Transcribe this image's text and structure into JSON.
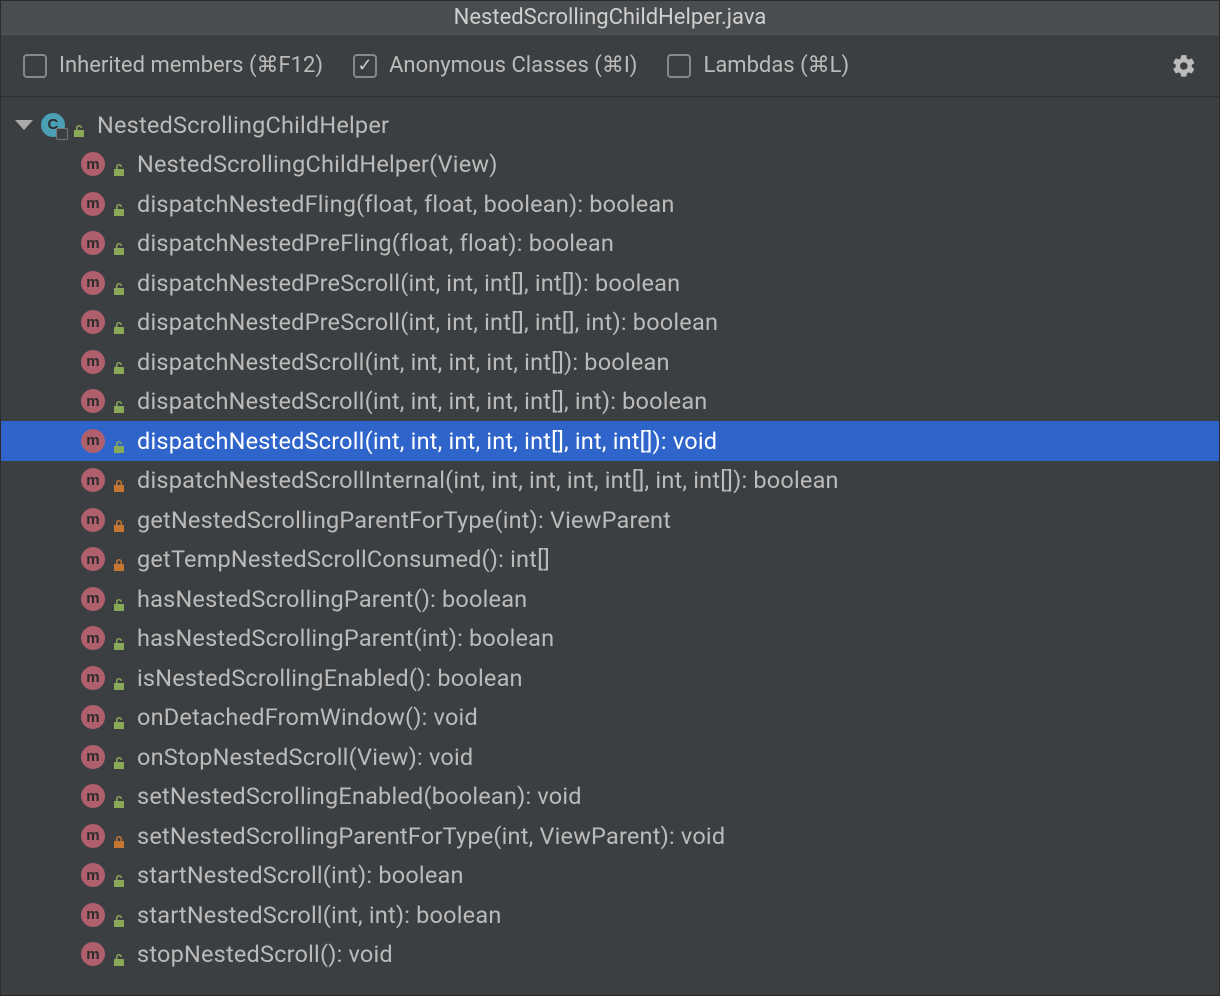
{
  "title": "NestedScrollingChildHelper.java",
  "filters": {
    "inherited": {
      "label": "Inherited members (⌘F12)",
      "checked": false
    },
    "anonymous": {
      "label": "Anonymous Classes (⌘I)",
      "checked": true
    },
    "lambdas": {
      "label": "Lambdas (⌘L)",
      "checked": false
    }
  },
  "class": {
    "name": "NestedScrollingChildHelper"
  },
  "members": [
    {
      "label": "NestedScrollingChildHelper(View)",
      "visibility": "public",
      "selected": false
    },
    {
      "label": "dispatchNestedFling(float, float, boolean): boolean",
      "visibility": "public",
      "selected": false
    },
    {
      "label": "dispatchNestedPreFling(float, float): boolean",
      "visibility": "public",
      "selected": false
    },
    {
      "label": "dispatchNestedPreScroll(int, int, int[], int[]): boolean",
      "visibility": "public",
      "selected": false
    },
    {
      "label": "dispatchNestedPreScroll(int, int, int[], int[], int): boolean",
      "visibility": "public",
      "selected": false
    },
    {
      "label": "dispatchNestedScroll(int, int, int, int, int[]): boolean",
      "visibility": "public",
      "selected": false
    },
    {
      "label": "dispatchNestedScroll(int, int, int, int, int[], int): boolean",
      "visibility": "public",
      "selected": false
    },
    {
      "label": "dispatchNestedScroll(int, int, int, int, int[], int, int[]): void",
      "visibility": "public",
      "selected": true
    },
    {
      "label": "dispatchNestedScrollInternal(int, int, int, int, int[], int, int[]): boolean",
      "visibility": "private",
      "selected": false
    },
    {
      "label": "getNestedScrollingParentForType(int): ViewParent",
      "visibility": "private",
      "selected": false
    },
    {
      "label": "getTempNestedScrollConsumed(): int[]",
      "visibility": "private",
      "selected": false
    },
    {
      "label": "hasNestedScrollingParent(): boolean",
      "visibility": "public",
      "selected": false
    },
    {
      "label": "hasNestedScrollingParent(int): boolean",
      "visibility": "public",
      "selected": false
    },
    {
      "label": "isNestedScrollingEnabled(): boolean",
      "visibility": "public",
      "selected": false
    },
    {
      "label": "onDetachedFromWindow(): void",
      "visibility": "public",
      "selected": false
    },
    {
      "label": "onStopNestedScroll(View): void",
      "visibility": "public",
      "selected": false
    },
    {
      "label": "setNestedScrollingEnabled(boolean): void",
      "visibility": "public",
      "selected": false
    },
    {
      "label": "setNestedScrollingParentForType(int, ViewParent): void",
      "visibility": "private",
      "selected": false
    },
    {
      "label": "startNestedScroll(int): boolean",
      "visibility": "public",
      "selected": false
    },
    {
      "label": "startNestedScroll(int, int): boolean",
      "visibility": "public",
      "selected": false
    },
    {
      "label": "stopNestedScroll(): void",
      "visibility": "public",
      "selected": false
    }
  ]
}
